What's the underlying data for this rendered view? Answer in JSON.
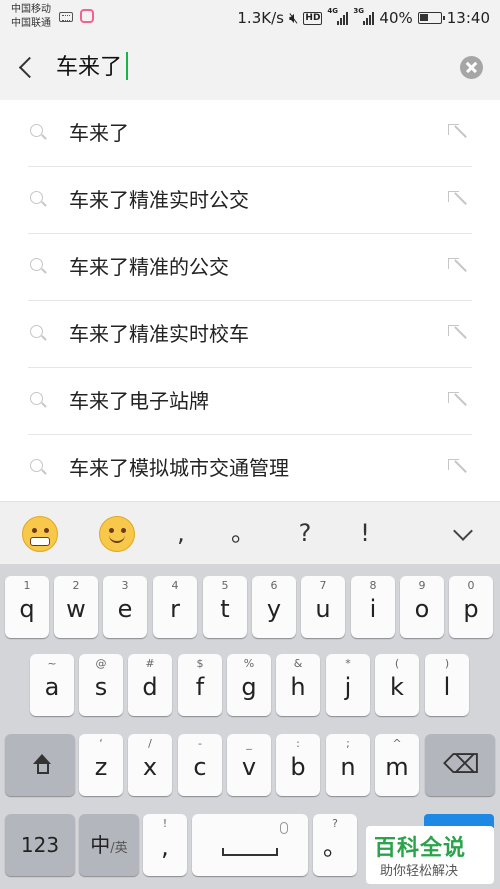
{
  "status_bar": {
    "carrier1": "中国移动",
    "carrier2": "中国联通",
    "speed": "1.3K/s",
    "net1": "4G",
    "net2": "3G",
    "battery": "40%",
    "time": "13:40"
  },
  "search": {
    "query": "车来了"
  },
  "suggestions": [
    {
      "text": "车来了"
    },
    {
      "text": "车来了精准实时公交"
    },
    {
      "text": "车来了精准的公交"
    },
    {
      "text": "车来了精准实时校车"
    },
    {
      "text": "车来了电子站牌"
    },
    {
      "text": "车来了模拟城市交通管理"
    }
  ],
  "quickbar": {
    "punct": [
      ",",
      "。",
      "?",
      "!"
    ]
  },
  "keyboard": {
    "row1": [
      {
        "hint": "1",
        "key": "q"
      },
      {
        "hint": "2",
        "key": "w"
      },
      {
        "hint": "3",
        "key": "e"
      },
      {
        "hint": "4",
        "key": "r"
      },
      {
        "hint": "5",
        "key": "t"
      },
      {
        "hint": "6",
        "key": "y"
      },
      {
        "hint": "7",
        "key": "u"
      },
      {
        "hint": "8",
        "key": "i"
      },
      {
        "hint": "9",
        "key": "o"
      },
      {
        "hint": "0",
        "key": "p"
      }
    ],
    "row2": [
      {
        "hint": "~",
        "key": "a"
      },
      {
        "hint": "@",
        "key": "s"
      },
      {
        "hint": "#",
        "key": "d"
      },
      {
        "hint": "$",
        "key": "f"
      },
      {
        "hint": "%",
        "key": "g"
      },
      {
        "hint": "&",
        "key": "h"
      },
      {
        "hint": "*",
        "key": "j"
      },
      {
        "hint": "(",
        "key": "k"
      },
      {
        "hint": ")",
        "key": "l"
      }
    ],
    "row3": [
      {
        "hint": "‘",
        "key": "z"
      },
      {
        "hint": "/",
        "key": "x"
      },
      {
        "hint": "-",
        "key": "c"
      },
      {
        "hint": "_",
        "key": "v"
      },
      {
        "hint": ":",
        "key": "b"
      },
      {
        "hint": ";",
        "key": "n"
      },
      {
        "hint": "^",
        "key": "m"
      }
    ],
    "num_key": "123",
    "lang_key": "中",
    "lang_key_sub": "/英",
    "comma_hint": "!",
    "comma_key": ",",
    "period_hint": "?",
    "period_key": "。"
  },
  "watermark": {
    "title": "百科全说",
    "subtitle": "助你轻松解决"
  }
}
